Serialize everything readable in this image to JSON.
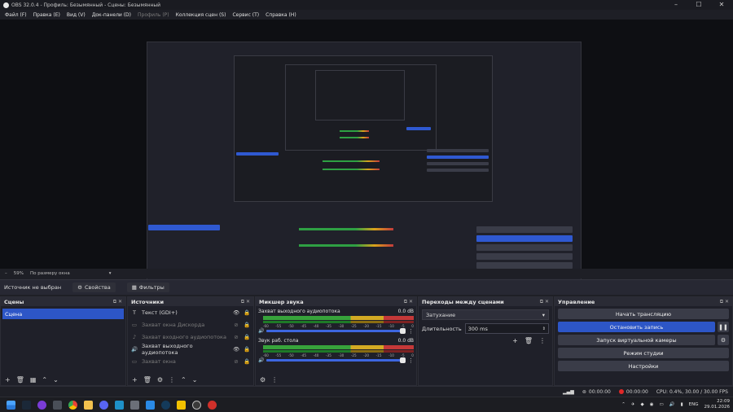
{
  "window": {
    "title": "OBS 32.0.4 - Профиль: Безымянный - Сцены: Безымянный",
    "minimize": "–",
    "maximize": "☐",
    "close": "✕"
  },
  "menu": [
    {
      "label": "Файл (F)",
      "enabled": true
    },
    {
      "label": "Правка (E)",
      "enabled": true
    },
    {
      "label": "Вид (V)",
      "enabled": true
    },
    {
      "label": "Док-панели (D)",
      "enabled": true
    },
    {
      "label": "Профиль (P)",
      "enabled": false
    },
    {
      "label": "Коллекция сцен (S)",
      "enabled": true
    },
    {
      "label": "Сервис (T)",
      "enabled": true
    },
    {
      "label": "Справка (H)",
      "enabled": true
    }
  ],
  "zoom": {
    "level": "59%",
    "mode": "По размеру окна"
  },
  "source_toolbar": {
    "status": "Источник не выбран",
    "properties": "Свойства",
    "filters": "Фильтры"
  },
  "scenes": {
    "title": "Сцены",
    "items": [
      "Сцена"
    ]
  },
  "sources": {
    "title": "Источники",
    "items": [
      {
        "name": "Текст (GDI+)",
        "visible": true,
        "dim": false,
        "icon": "text-icon"
      },
      {
        "name": "Захват окна Дискорда",
        "visible": false,
        "dim": true,
        "icon": "window-icon"
      },
      {
        "name": "Захват входного аудиопотока",
        "visible": false,
        "dim": true,
        "icon": "mic-icon"
      },
      {
        "name": "Захват выходного аудиопотока",
        "visible": true,
        "dim": false,
        "icon": "speaker-icon"
      },
      {
        "name": "Захват окна",
        "visible": false,
        "dim": true,
        "icon": "window-icon"
      }
    ]
  },
  "mixer": {
    "title": "Микшер звука",
    "channels": [
      {
        "name": "Захват выходного аудиопотока",
        "db": "0.0 dB",
        "level": 1.0
      },
      {
        "name": "Звук раб. стола",
        "db": "0.0 dB",
        "level": 1.0
      }
    ],
    "ticks": [
      "-60",
      "-55",
      "-50",
      "-45",
      "-40",
      "-35",
      "-30",
      "-25",
      "-20",
      "-15",
      "-10",
      "-5",
      "0"
    ]
  },
  "transitions": {
    "title": "Переходы между сценами",
    "selected": "Затухание",
    "duration_label": "Длительность",
    "duration_value": "300 ms"
  },
  "controls": {
    "title": "Управление",
    "start_stream": "Начать трансляцию",
    "stop_record": "Остановить запись",
    "virtual_cam": "Запуск виртуальной камеры",
    "studio_mode": "Режим студии",
    "settings": "Настройки"
  },
  "status": {
    "stream_time": "00:00:00",
    "rec_time": "00:00:00",
    "cpu": "CPU: 0.4%, 30.00 / 30.00 FPS"
  },
  "tray": {
    "lang": "ENG",
    "time": "22:09",
    "date": "29.01.2026"
  },
  "colors": {
    "accent": "#2d56c7",
    "record": "#e02828",
    "bg": "#1e1f26"
  }
}
